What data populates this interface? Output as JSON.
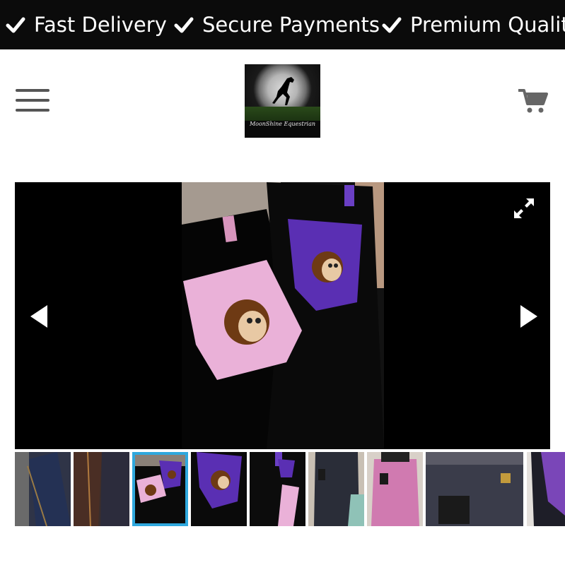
{
  "announcement_bar": {
    "items": [
      {
        "label": "Fast Delivery",
        "icon": "check-icon"
      },
      {
        "label": "Secure Payments",
        "icon": "check-icon"
      },
      {
        "label": "Premium Quality",
        "icon": "check-icon"
      }
    ]
  },
  "header": {
    "menu_icon": "hamburger-menu-icon",
    "logo_text": "MoonShine Equestrian",
    "cart_icon": "shopping-cart-icon"
  },
  "gallery": {
    "prev_icon": "arrow-left-icon",
    "next_icon": "arrow-right-icon",
    "expand_icon": "expand-fullscreen-icon",
    "selected_index": 2,
    "thumbnail_count": 10,
    "accent_color": "#2fa8de"
  }
}
